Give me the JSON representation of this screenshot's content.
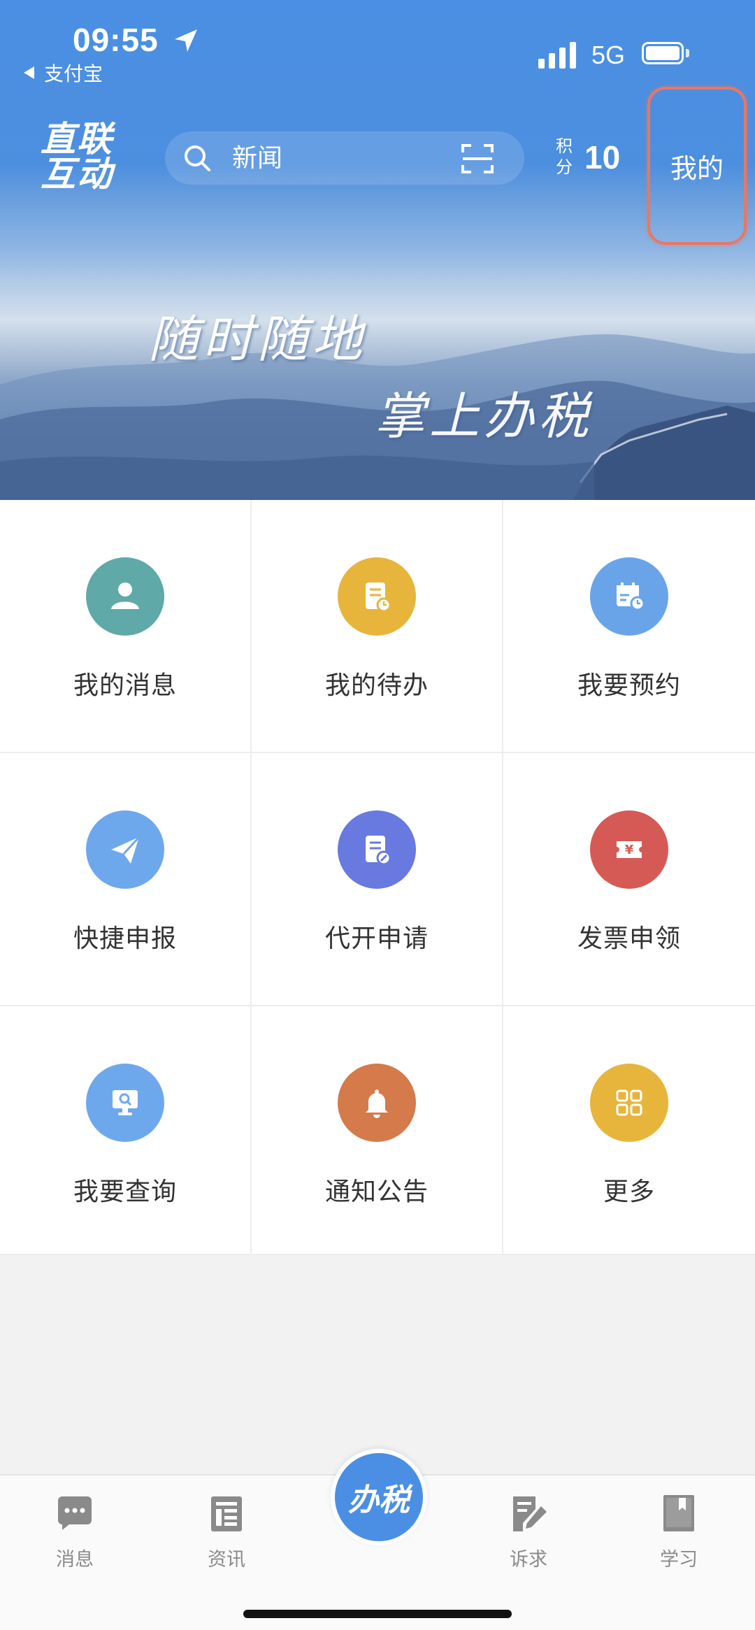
{
  "status_bar": {
    "time": "09:55",
    "back_app": "支付宝",
    "network": "5G"
  },
  "header": {
    "logo_line1": "直联",
    "logo_line2": "互动",
    "search_placeholder": "新闻",
    "points_label_line1": "积",
    "points_label_line2": "分",
    "points_value": "10",
    "mine_label": "我的"
  },
  "banner": {
    "slogan_line1": "随时随地",
    "slogan_line2": "掌上办税"
  },
  "grid": {
    "items": [
      {
        "label": "我的消息",
        "icon": "user-icon",
        "color": "#5fa9a8"
      },
      {
        "label": "我的待办",
        "icon": "todo-doc-icon",
        "color": "#e7b53b"
      },
      {
        "label": "我要预约",
        "icon": "calendar-icon",
        "color": "#6aa4e8"
      },
      {
        "label": "快捷申报",
        "icon": "paper-plane-icon",
        "color": "#6ea8ec"
      },
      {
        "label": "代开申请",
        "icon": "doc-edit-icon",
        "color": "#6879df"
      },
      {
        "label": "发票申领",
        "icon": "yuan-ticket-icon",
        "color": "#d55a55"
      },
      {
        "label": "我要查询",
        "icon": "monitor-search-icon",
        "color": "#6ea8ec"
      },
      {
        "label": "通知公告",
        "icon": "bell-icon",
        "color": "#d57a4a"
      },
      {
        "label": "更多",
        "icon": "grid-more-icon",
        "color": "#e7b53b"
      }
    ]
  },
  "tabbar": {
    "tabs": [
      {
        "label": "消息",
        "icon": "chat-bubble-icon"
      },
      {
        "label": "资讯",
        "icon": "news-icon"
      },
      {
        "label": "诉求",
        "icon": "edit-note-icon"
      },
      {
        "label": "学习",
        "icon": "book-icon"
      }
    ],
    "center_label": "办税"
  },
  "colors": {
    "primary": "#4a8fe3",
    "highlight_border": "#e87765"
  }
}
